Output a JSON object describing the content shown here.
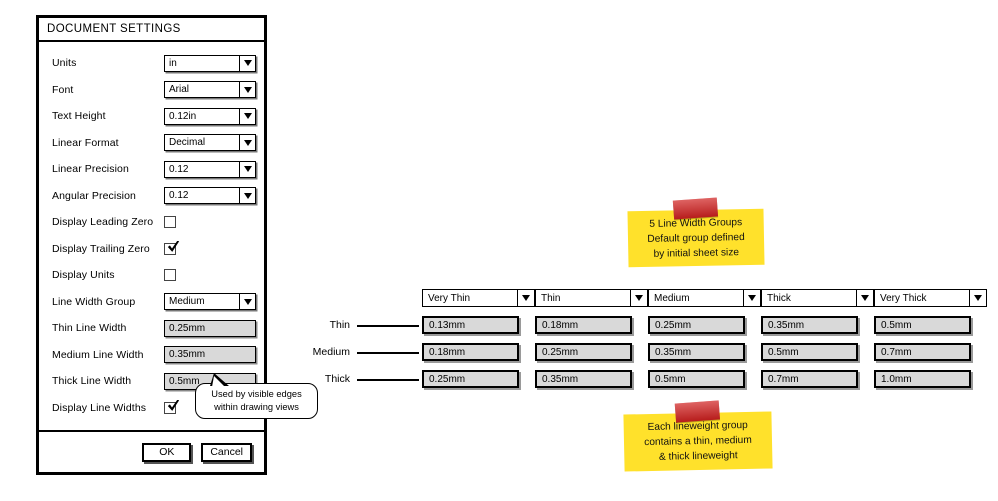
{
  "dialog": {
    "title": "DOCUMENT SETTINGS",
    "rows": [
      {
        "label": "Units",
        "type": "combo",
        "value": "in"
      },
      {
        "label": "Font",
        "type": "combo",
        "value": "Arial"
      },
      {
        "label": "Text Height",
        "type": "combo",
        "value": "0.12in"
      },
      {
        "label": "Linear Format",
        "type": "combo",
        "value": "Decimal"
      },
      {
        "label": "Linear Precision",
        "type": "combo",
        "value": "0.12"
      },
      {
        "label": "Angular Precision",
        "type": "combo",
        "value": "0.12"
      },
      {
        "label": "Display Leading Zero",
        "type": "checkbox",
        "checked": false
      },
      {
        "label": "Display Trailing Zero",
        "type": "checkbox",
        "checked": true
      },
      {
        "label": "Display Units",
        "type": "checkbox",
        "checked": false
      },
      {
        "label": "Line Width Group",
        "type": "combo",
        "value": "Medium"
      },
      {
        "label": "Thin Line Width",
        "type": "field",
        "value": "0.25mm"
      },
      {
        "label": "Medium Line Width",
        "type": "field",
        "value": "0.35mm"
      },
      {
        "label": "Thick Line Width",
        "type": "field",
        "value": "0.5mm"
      },
      {
        "label": "Display Line Widths",
        "type": "checkbox",
        "checked": true
      }
    ],
    "buttons": {
      "ok": "OK",
      "cancel": "Cancel"
    }
  },
  "callout": {
    "line1": "Used by visible edges",
    "line2": "within drawing views"
  },
  "table": {
    "row_labels": [
      "Thin",
      "Medium",
      "Thick"
    ],
    "group_headers": [
      "Very Thin",
      "Thin",
      "Medium",
      "Thick",
      "Very Thick"
    ],
    "values": [
      [
        "0.13mm",
        "0.18mm",
        "0.25mm",
        "0.35mm",
        "0.5mm"
      ],
      [
        "0.18mm",
        "0.25mm",
        "0.35mm",
        "0.5mm",
        "0.7mm"
      ],
      [
        "0.25mm",
        "0.35mm",
        "0.5mm",
        "0.7mm",
        "1.0mm"
      ]
    ]
  },
  "notes": {
    "top": {
      "line1": "5 Line Width Groups",
      "line2": "Default group defined",
      "line3": "by initial sheet size"
    },
    "bottom": {
      "line1": "Each lineweight group",
      "line2": "contains a thin, medium",
      "line3": "& thick lineweight"
    }
  },
  "colors": {
    "sticky_yellow": "#ffe12b",
    "tape_red": "#d0201f",
    "field_grey": "#d9d9d9",
    "outline": "#000000"
  }
}
